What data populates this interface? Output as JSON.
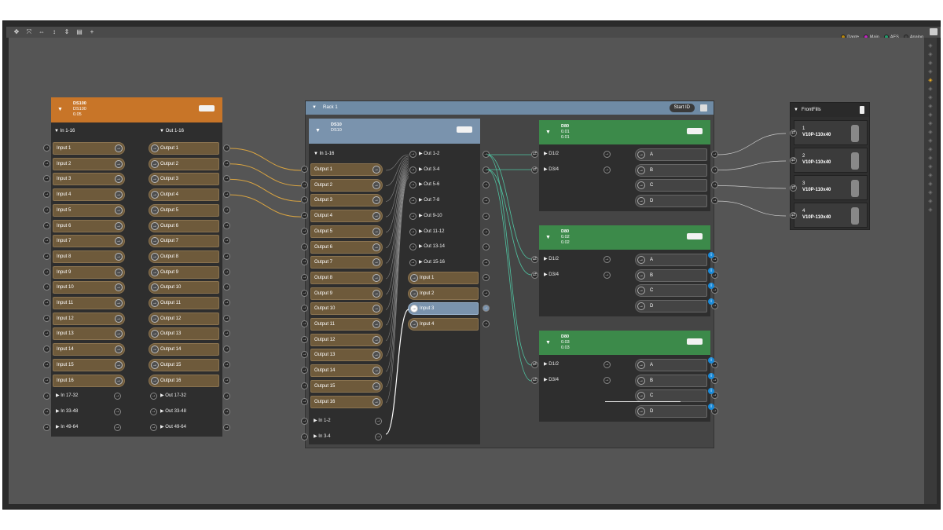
{
  "legend": [
    {
      "label": "Dante",
      "color": "#b8860b"
    },
    {
      "label": "Main",
      "color": "#c024c0"
    },
    {
      "label": "AES",
      "color": "#1f9e6b"
    },
    {
      "label": "Analog",
      "color": "#444444"
    }
  ],
  "toolbar": {
    "icons": [
      "move-icon",
      "fit-icon",
      "expand-h-icon",
      "align-v-icon",
      "distribute-v-icon",
      "clipboard-icon",
      "add-icon"
    ]
  },
  "ds100": {
    "name": "DS100",
    "model": "DS100",
    "ip": "0.05",
    "color": "#c87528",
    "in_header": "In 1-16",
    "out_header": "Out 1-16",
    "inputs": [
      "Input 1",
      "Input 2",
      "Input 3",
      "Input 4",
      "Input 5",
      "Input 6",
      "Input 7",
      "Input 8",
      "Input 9",
      "Input 10",
      "Input 11",
      "Input 12",
      "Input 13",
      "Input 14",
      "Input 15",
      "Input 16"
    ],
    "outputs": [
      "Output 1",
      "Output 2",
      "Output 3",
      "Output 4",
      "Output 5",
      "Output 6",
      "Output 7",
      "Output 8",
      "Output 9",
      "Output 10",
      "Output 11",
      "Output 12",
      "Output 13",
      "Output 14",
      "Output 15",
      "Output 16"
    ],
    "in_groups": [
      "In 17-32",
      "In 33-48",
      "In 49-64"
    ],
    "out_groups": [
      "Out 17-32",
      "Out 33-48",
      "Out 49-64"
    ]
  },
  "rack": {
    "title": "Rack 1",
    "start_id": "Start ID",
    "ds10": {
      "name": "DS10",
      "model": "DS10",
      "color": "#7a93ad",
      "in_header": "In 1-16",
      "outputs": [
        "Output 1",
        "Output 2",
        "Output 3",
        "Output 4",
        "Output 5",
        "Output 6",
        "Output 7",
        "Output 8",
        "Output 9",
        "Output 10",
        "Output 11",
        "Output 12",
        "Output 13",
        "Output 14",
        "Output 15",
        "Output 16"
      ],
      "out_groups": [
        "Out 1-2",
        "Out 3-4",
        "Out 5-6",
        "Out 7-8",
        "Out 9-10",
        "Out 11-12",
        "Out 13-14",
        "Out 15-16"
      ],
      "inputs": [
        "Input 1",
        "Input 2",
        "Input 3",
        "Input 4"
      ],
      "in_groups": [
        "In 1-2",
        "In 3-4"
      ]
    },
    "d80": [
      {
        "name": "D80",
        "id1": "0.01",
        "id2": "0.01",
        "color": "#3c8a4a",
        "inputs": [
          "D1/2",
          "D3/4"
        ],
        "outputs": [
          "A",
          "B",
          "C",
          "D"
        ]
      },
      {
        "name": "D80",
        "id1": "0.02",
        "id2": "0.02",
        "color": "#3c8a4a",
        "inputs": [
          "D1/2",
          "D3/4"
        ],
        "outputs": [
          "A",
          "B",
          "C",
          "D"
        ]
      },
      {
        "name": "D80",
        "id1": "0.03",
        "id2": "0.03",
        "color": "#3c8a4a",
        "inputs": [
          "D1/2",
          "D3/4"
        ],
        "outputs": [
          "A",
          "B",
          "C",
          "D"
        ]
      }
    ]
  },
  "frontfills": {
    "title": "FrontFills",
    "items": [
      {
        "num": "1",
        "model": "V10P-110x40"
      },
      {
        "num": "2",
        "model": "V10P-110x40"
      },
      {
        "num": "3",
        "model": "V10P-110x40"
      },
      {
        "num": "4",
        "model": "V10P-110x40"
      }
    ]
  }
}
